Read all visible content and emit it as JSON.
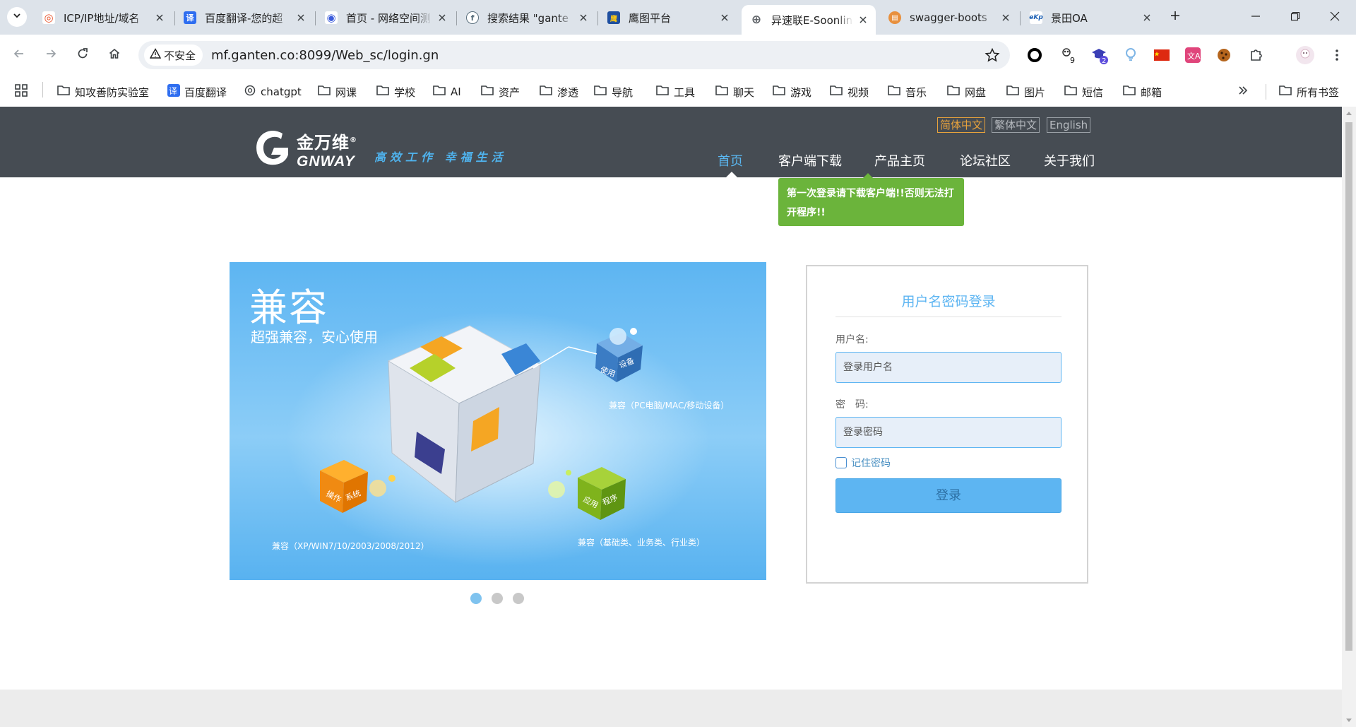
{
  "tabs": [
    {
      "title": "ICP/IP地址/域名",
      "favicon_color": "#e8532b",
      "favicon_glyph": "◎",
      "favicon_icon": "tool-favicon-icon"
    },
    {
      "title": "百度翻译-您的超",
      "favicon_color": "#2f6ef0",
      "favicon_glyph": "译",
      "favicon_icon": "baidu-translate-favicon-icon"
    },
    {
      "title": "首页 - 网络空间测",
      "favicon_color": "#3b5bdb",
      "favicon_glyph": "◉",
      "favicon_icon": "eye-favicon-icon"
    },
    {
      "title": "搜索结果 \"gante",
      "favicon_color": "#5a6f7d",
      "favicon_glyph": "f",
      "favicon_icon": "fofa-favicon-icon"
    },
    {
      "title": "鹰图平台",
      "favicon_color": "#1f4fa0",
      "favicon_glyph": "鹰",
      "favicon_icon": "hunter-favicon-icon"
    },
    {
      "title": "异速联E-Soonlin",
      "favicon_color": "#5f6368",
      "favicon_glyph": "⊕",
      "favicon_icon": "globe-favicon-icon"
    },
    {
      "title": "swagger-boots",
      "favicon_color": "#e8903e",
      "favicon_glyph": "▤",
      "favicon_icon": "document-favicon-icon"
    },
    {
      "title": "景田OA",
      "favicon_color": "#1a5fb4",
      "favicon_glyph": "eKp",
      "favicon_icon": "ekp-favicon-icon"
    }
  ],
  "active_tab_index": 5,
  "toolbar": {
    "security_label": "不安全",
    "url": "mf.ganten.co:8099/Web_sc/login.gn",
    "ext_badge_1": "9",
    "ext_badge_2": "2"
  },
  "bookmarks": [
    {
      "label": "知攻善防实验室",
      "icon": "folder-icon"
    },
    {
      "label": "百度翻译",
      "icon": "baidu-translate-icon"
    },
    {
      "label": "chatgpt",
      "icon": "openai-icon"
    },
    {
      "label": "网课",
      "icon": "folder-icon"
    },
    {
      "label": "学校",
      "icon": "folder-icon"
    },
    {
      "label": "AI",
      "icon": "folder-icon"
    },
    {
      "label": "资产",
      "icon": "folder-icon"
    },
    {
      "label": "渗透",
      "icon": "folder-icon"
    },
    {
      "label": "导航",
      "icon": "folder-icon"
    },
    {
      "label": "工具",
      "icon": "folder-icon"
    },
    {
      "label": "聊天",
      "icon": "folder-icon"
    },
    {
      "label": "游戏",
      "icon": "folder-icon"
    },
    {
      "label": "视频",
      "icon": "folder-icon"
    },
    {
      "label": "音乐",
      "icon": "folder-icon"
    },
    {
      "label": "网盘",
      "icon": "folder-icon"
    },
    {
      "label": "图片",
      "icon": "folder-icon"
    },
    {
      "label": "短信",
      "icon": "folder-icon"
    },
    {
      "label": "邮箱",
      "icon": "folder-icon"
    }
  ],
  "all_bookmarks_label": "所有书签",
  "site": {
    "logo_cn": "金万维",
    "logo_en": "GNWAY",
    "logo_reg": "®",
    "slogan": "高效工作 幸福生活",
    "languages": [
      "简体中文",
      "繁体中文",
      "English"
    ],
    "active_language_index": 0,
    "nav": [
      "首页",
      "客户端下载",
      "产品主页",
      "论坛社区",
      "关于我们"
    ],
    "active_nav_index": 0,
    "tooltip": "第一次登录请下载客户端!!否则无法打开程序!!",
    "accent_color": "#5db5f2",
    "tooltip_color": "#6bb43b",
    "header_color": "#464c53"
  },
  "banner": {
    "title": "兼容",
    "subtitle": "超强兼容，安心使用",
    "cap_devices": "兼容（PC电脑/MAC/移动设备）",
    "cap_os": "兼容（XP/WIN7/10/2003/2008/2012）",
    "cap_apps": "兼容（基础类、业务类、行业类）",
    "cube_devices": [
      "使用",
      "设备"
    ],
    "cube_os": [
      "操作",
      "系统"
    ],
    "cube_apps": [
      "应用",
      "程序"
    ],
    "slide_count": 3,
    "active_slide": 0
  },
  "login": {
    "title": "用户名密码登录",
    "username_label": "用户名:",
    "username_placeholder": "登录用户名",
    "password_label": "密　码:",
    "password_placeholder": "登录密码",
    "remember_label": "记住密码",
    "remember_checked": false,
    "submit_label": "登录"
  }
}
